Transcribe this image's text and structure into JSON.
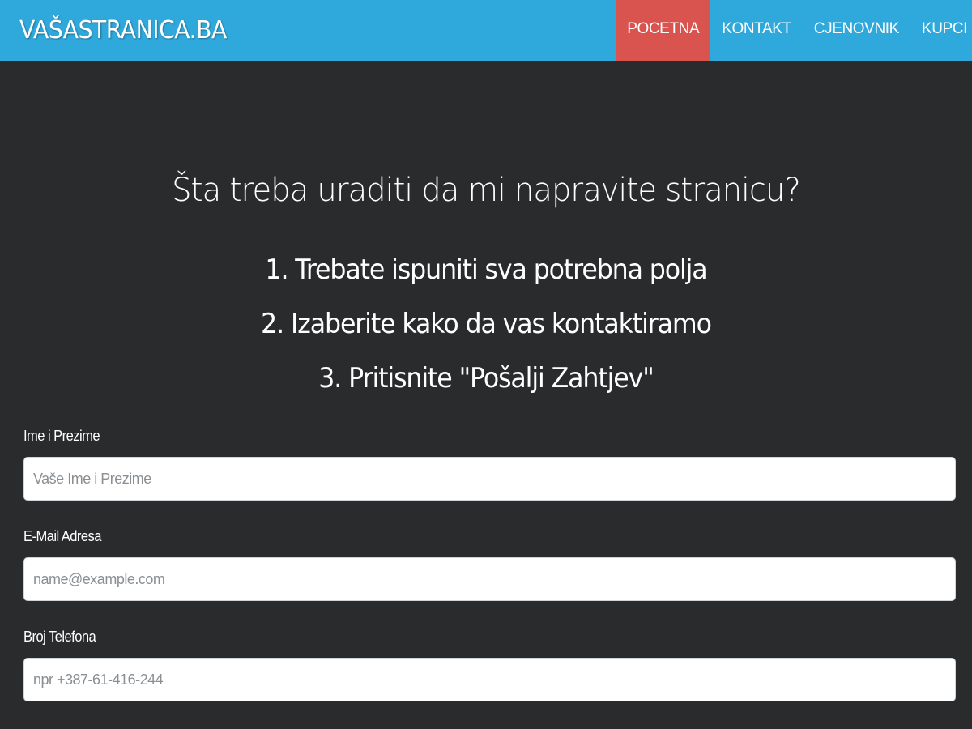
{
  "brand": "VAŠASTRANICA.BA",
  "nav": {
    "items": [
      "POCETNA",
      "KONTAKT",
      "CJENOVNIK",
      "KUPCI"
    ],
    "active_index": 0
  },
  "hero": {
    "title": "Šta treba uraditi da mi napravite stranicu?",
    "steps": [
      "1. Trebate ispuniti sva potrebna polja",
      "2. Izaberite kako da vas kontaktiramo",
      "3. Pritisnite \"Pošalji Zahtjev\""
    ]
  },
  "form": {
    "name": {
      "label": "Ime i Prezime",
      "placeholder": "Vaše Ime i Prezime",
      "value": ""
    },
    "email": {
      "label": "E-Mail Adresa",
      "placeholder": "name@example.com",
      "value": ""
    },
    "phone": {
      "label": "Broj Telefona",
      "placeholder": "npr +387-61-416-244",
      "value": ""
    }
  },
  "colors": {
    "navbar": "#2fa8dc",
    "active_nav": "#d9534f",
    "background": "#2a2b2d"
  }
}
